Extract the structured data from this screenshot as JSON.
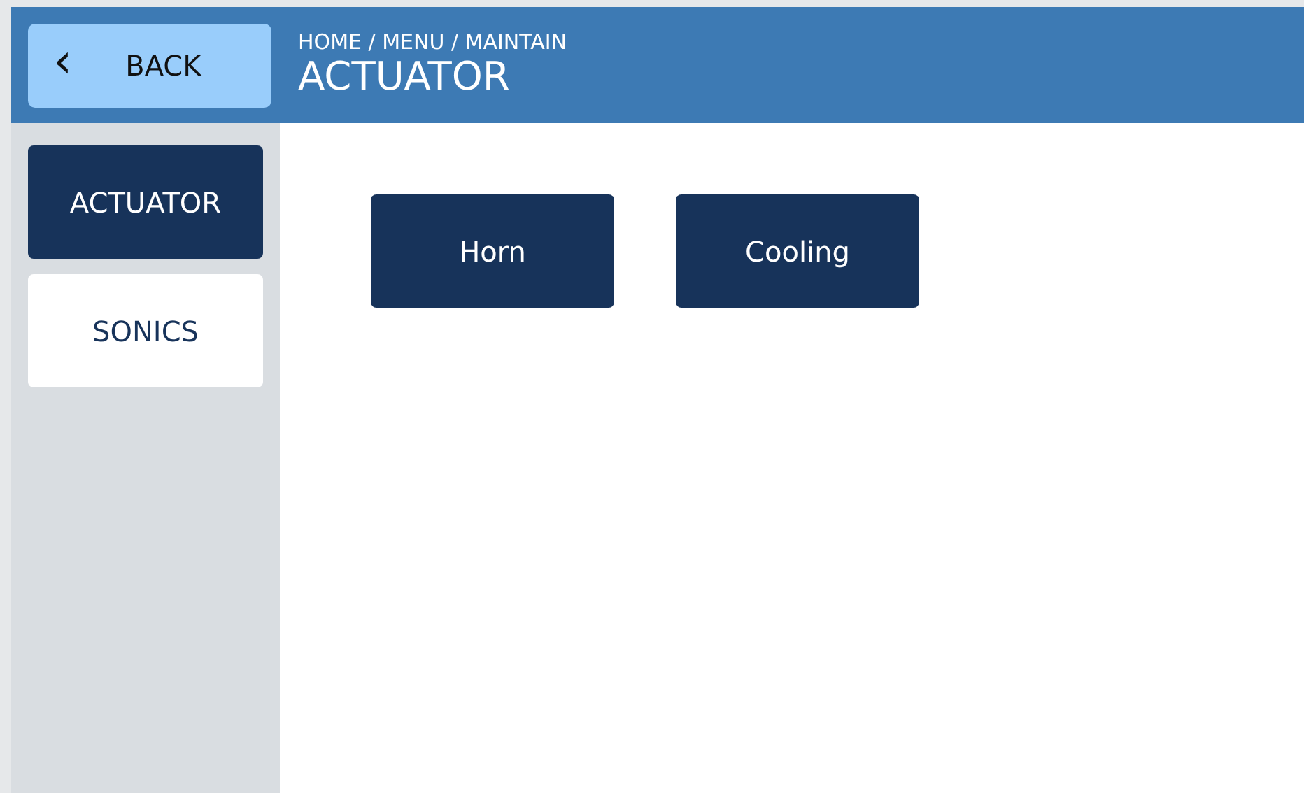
{
  "header": {
    "back_button": {
      "icon": "‹",
      "label": "BACK"
    },
    "breadcrumb": "HOME / MENU / MAINTAIN",
    "title": "ACTUATOR"
  },
  "sidebar": {
    "items": [
      {
        "label": "ACTUATOR",
        "selected": true
      },
      {
        "label": "SONICS",
        "selected": false
      }
    ]
  },
  "actions": [
    "Horn",
    "Cooling"
  ]
}
